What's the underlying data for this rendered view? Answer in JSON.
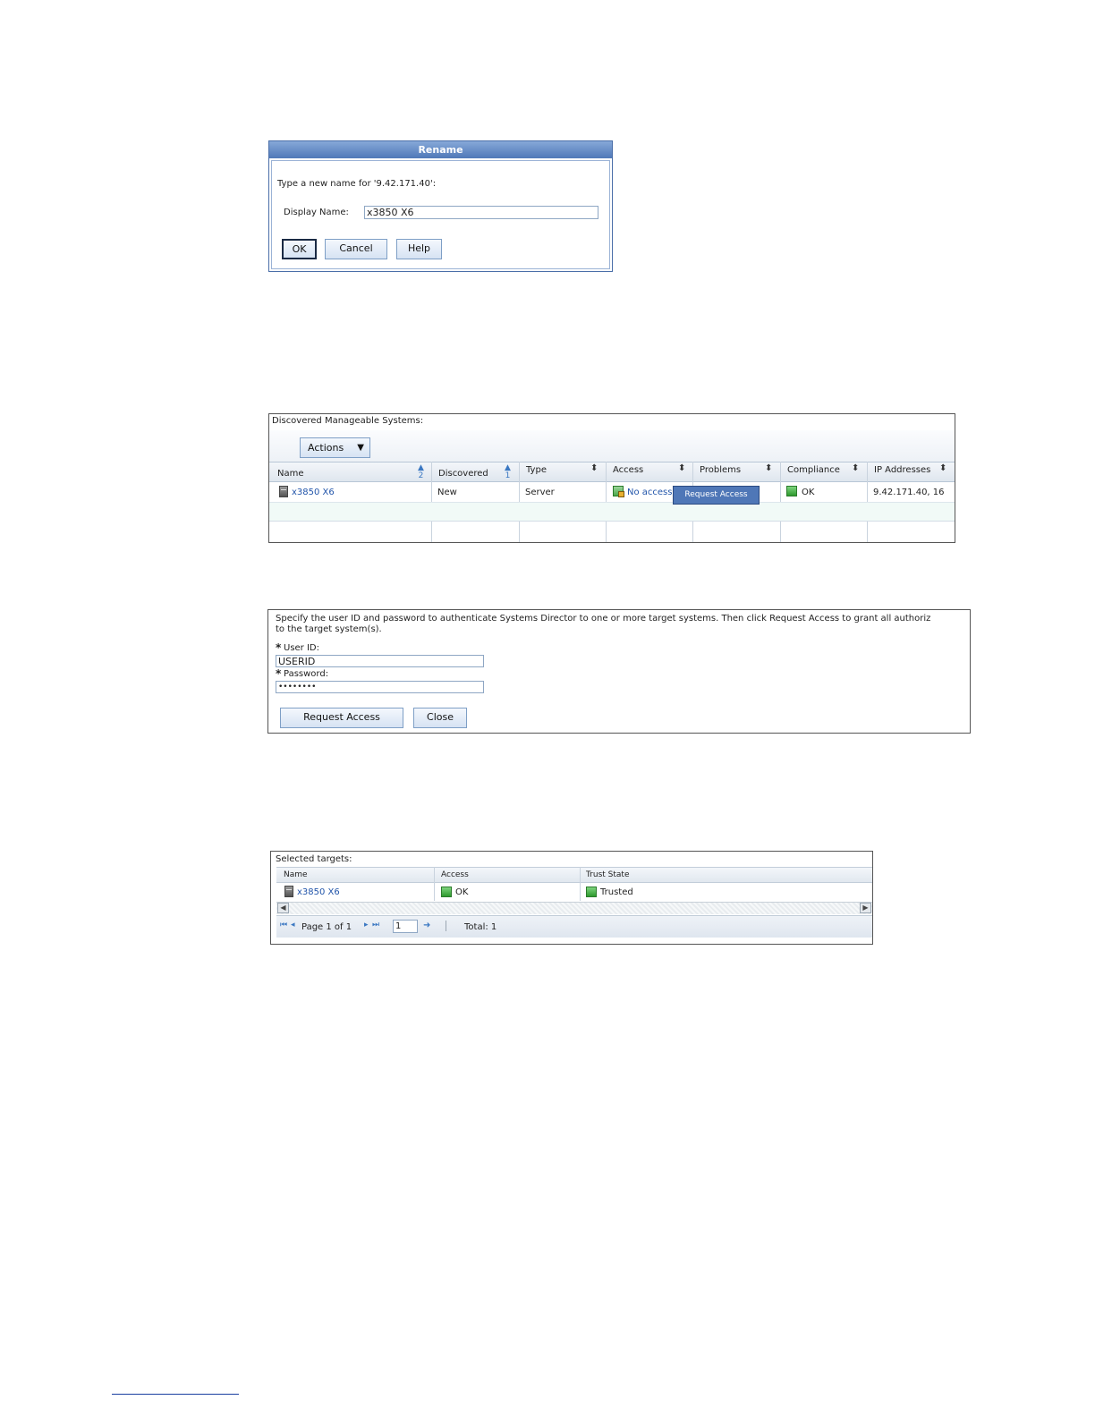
{
  "rename_dialog": {
    "title": "Rename",
    "prompt": "Type a new name for '9.42.171.40':",
    "display_name_label": "Display Name:",
    "display_name_value": "x3850 X6",
    "ok_label": "OK",
    "cancel_label": "Cancel",
    "help_label": "Help"
  },
  "discovered": {
    "title": "Discovered Manageable Systems:",
    "actions_label": "Actions",
    "columns": [
      "Name",
      "Discovered",
      "Type",
      "Access",
      "Problems",
      "Compliance",
      "IP Addresses"
    ],
    "sort_badges": {
      "name": "2",
      "discovered": "1"
    },
    "row": {
      "name": "x3850 X6",
      "discovered": "New",
      "type": "Server",
      "access": "No access",
      "compliance": "OK",
      "ip": "9.42.171.40, 16"
    },
    "popup_label": "Request Access"
  },
  "request_access": {
    "instructions_line1": "Specify the user ID and password to authenticate Systems Director to one or more target systems. Then click Request Access to grant all authoriz",
    "instructions_line2": "to the target system(s).",
    "required_mark": "*",
    "user_id_label": "User ID:",
    "user_id_value": "USERID",
    "password_label": "Password:",
    "password_value": "••••••••",
    "request_label": "Request Access",
    "close_label": "Close"
  },
  "selected_targets": {
    "title": "Selected targets:",
    "columns": [
      "Name",
      "Access",
      "Trust State"
    ],
    "row": {
      "name": "x3850 X6",
      "access": "OK",
      "trust": "Trusted"
    },
    "page_text": "Page 1 of 1",
    "page_input": "1",
    "total_text": "Total: 1"
  }
}
